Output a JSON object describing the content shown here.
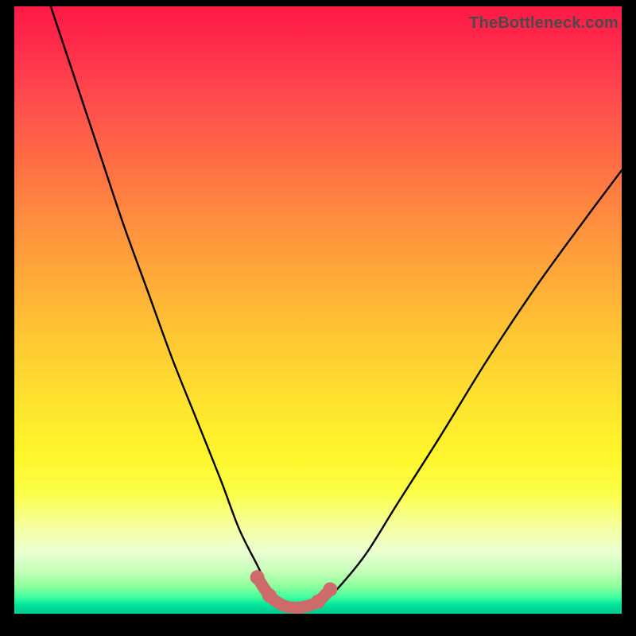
{
  "watermark": "TheBottleneck.com",
  "chart_data": {
    "type": "line",
    "title": "",
    "xlabel": "",
    "ylabel": "",
    "xlim": [
      0,
      100
    ],
    "ylim": [
      0,
      100
    ],
    "grid": false,
    "series": [
      {
        "name": "bottleneck-curve",
        "color": "#000000",
        "x": [
          6,
          10,
          14,
          18,
          22,
          26,
          30,
          34,
          37,
          40,
          42,
          44,
          46,
          48,
          51,
          54,
          58,
          63,
          70,
          78,
          86,
          94,
          100
        ],
        "y": [
          100,
          88,
          76,
          64,
          53,
          42,
          32,
          22,
          14,
          8,
          4,
          2,
          1,
          1,
          2,
          5,
          10,
          18,
          29,
          42,
          54,
          65,
          73
        ]
      },
      {
        "name": "highlight-segment",
        "color": "#cf6a6a",
        "x": [
          40,
          42,
          44,
          46,
          48,
          50,
          52
        ],
        "y": [
          6,
          3,
          1.5,
          1,
          1.2,
          2,
          4
        ]
      }
    ],
    "annotations": []
  }
}
